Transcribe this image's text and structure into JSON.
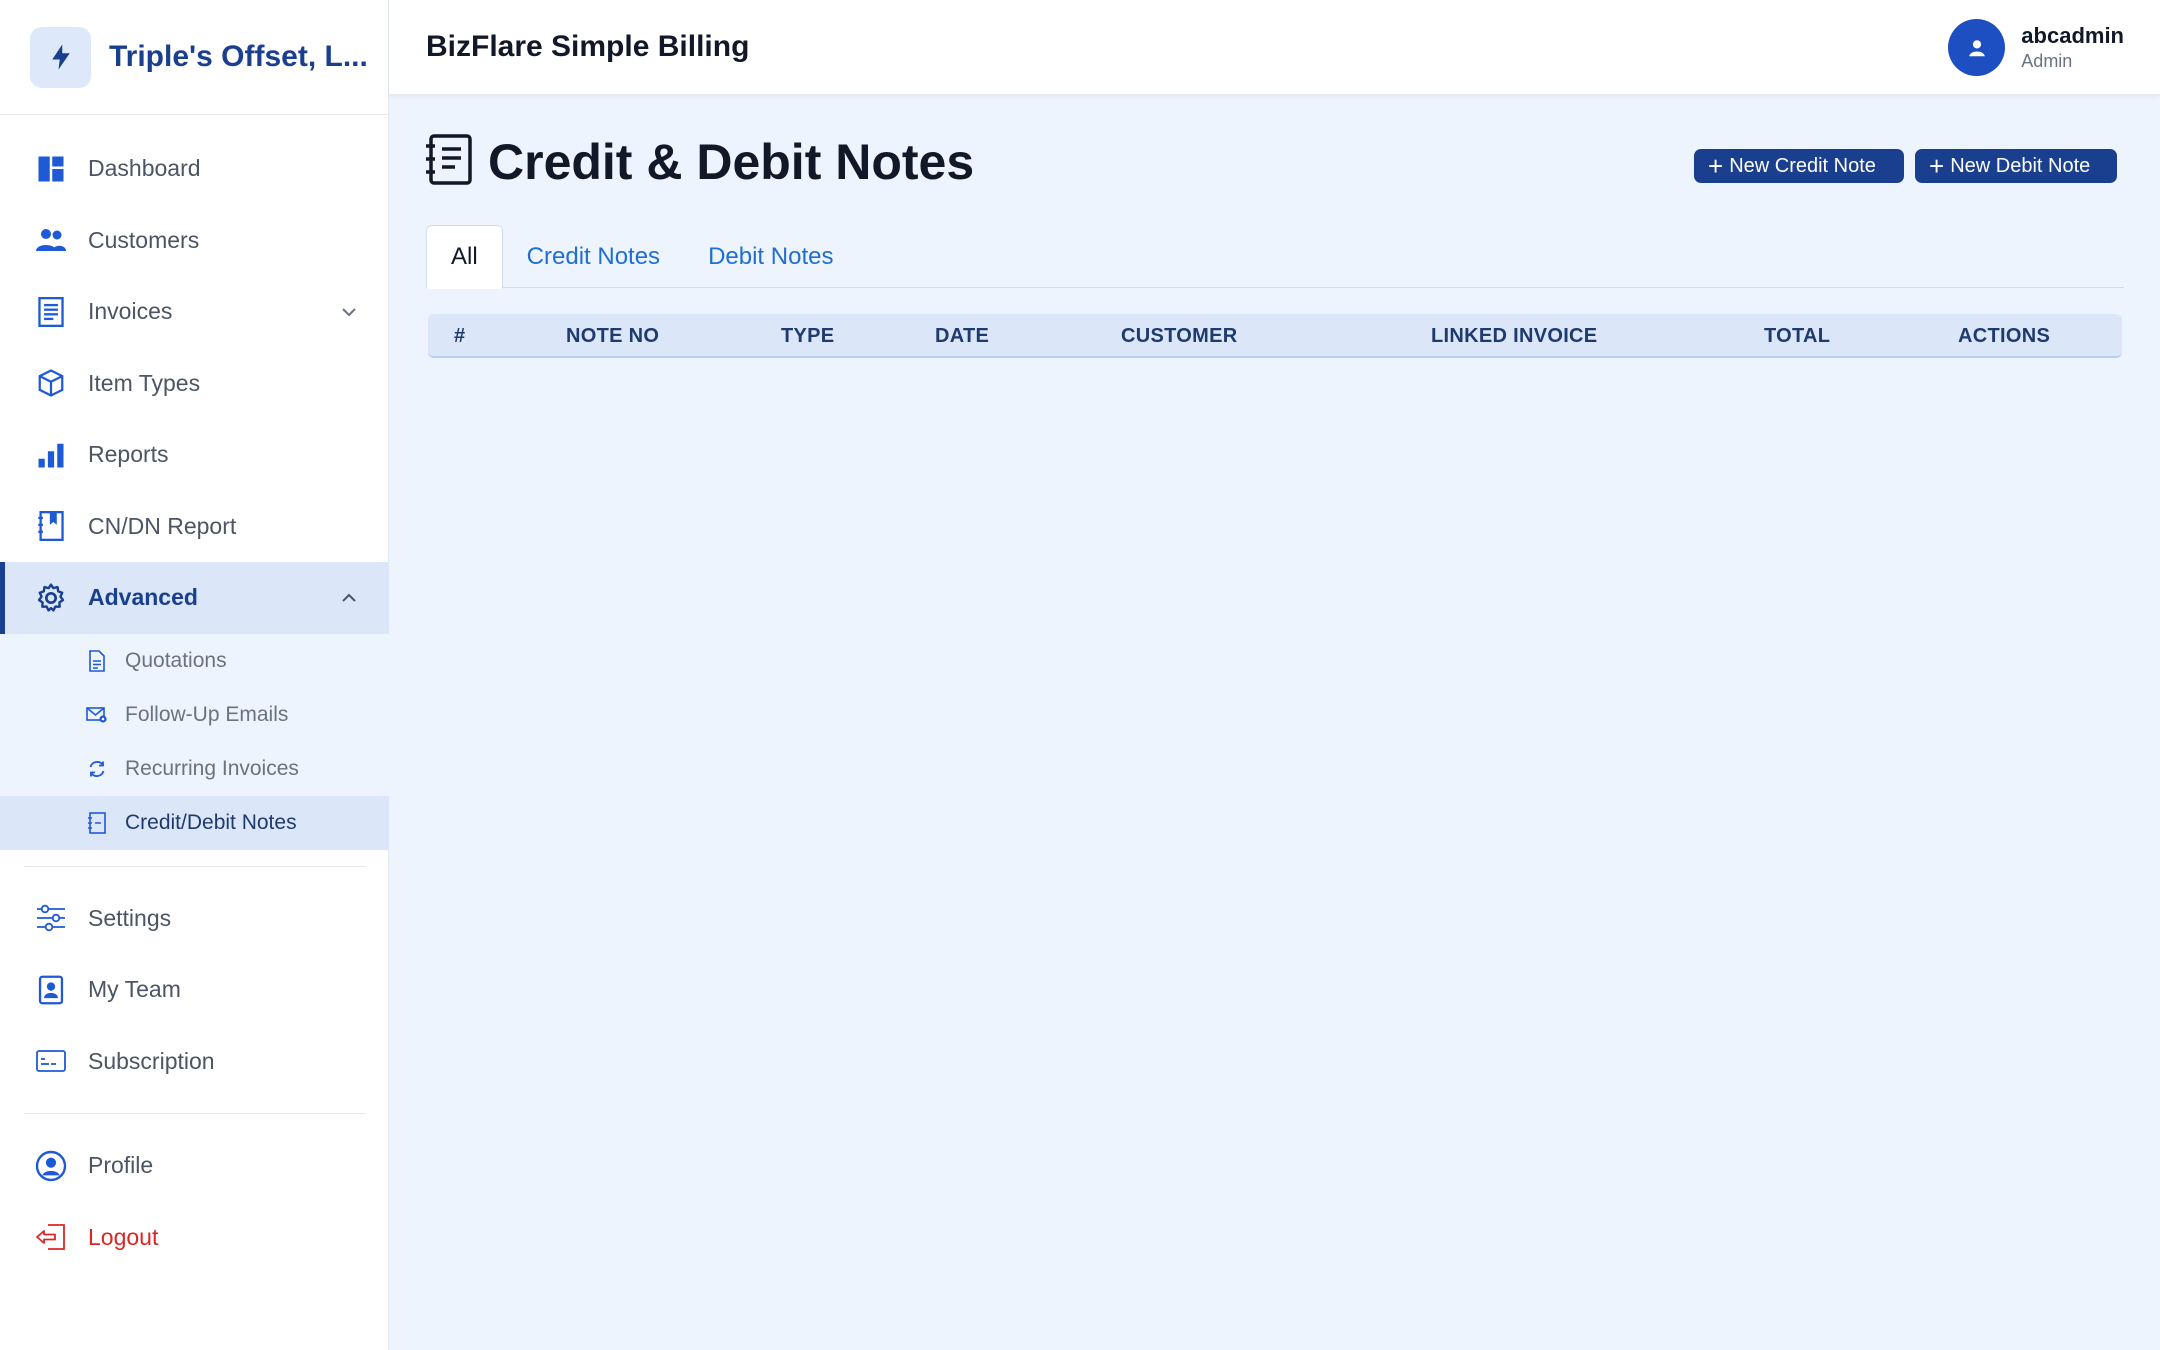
{
  "brand": {
    "name": "Triple's Offset, L...",
    "icon": "lightning-icon"
  },
  "sidebar": {
    "items": [
      {
        "label": "Dashboard",
        "icon": "dashboard-icon"
      },
      {
        "label": "Customers",
        "icon": "users-icon"
      },
      {
        "label": "Invoices",
        "icon": "invoice-icon"
      },
      {
        "label": "Item Types",
        "icon": "box-icon"
      },
      {
        "label": "Reports",
        "icon": "bar-chart-icon"
      },
      {
        "label": "CN/DN Report",
        "icon": "bookmark-book-icon"
      },
      {
        "label": "Advanced",
        "icon": "gear-icon"
      }
    ],
    "sub_items": [
      {
        "label": "Quotations",
        "icon": "document-icon"
      },
      {
        "label": "Follow-Up Emails",
        "icon": "email-gear-icon"
      },
      {
        "label": "Recurring Invoices",
        "icon": "refresh-icon"
      },
      {
        "label": "Credit/Debit Notes",
        "icon": "notes-icon"
      }
    ],
    "lower_items": [
      {
        "label": "Settings",
        "icon": "sliders-icon"
      },
      {
        "label": "My Team",
        "icon": "id-badge-icon"
      },
      {
        "label": "Subscription",
        "icon": "card-icon"
      }
    ],
    "bottom_items": [
      {
        "label": "Profile",
        "icon": "user-circle-icon"
      },
      {
        "label": "Logout",
        "icon": "logout-icon"
      }
    ]
  },
  "header": {
    "title": "BizFlare Simple Billing",
    "user": {
      "name": "abcadmin",
      "role": "Admin"
    }
  },
  "page": {
    "title": "Credit & Debit Notes",
    "buttons": {
      "new_credit": "New Credit Note",
      "new_debit": "New Debit Note"
    },
    "tabs": [
      "All",
      "Credit Notes",
      "Debit Notes"
    ],
    "active_tab": "All",
    "columns": [
      "#",
      "NOTE NO",
      "TYPE",
      "DATE",
      "CUSTOMER",
      "LINKED INVOICE",
      "TOTAL",
      "ACTIONS"
    ],
    "rows": []
  },
  "colors": {
    "primary": "#1a3f8f",
    "accent": "#1f6fd1",
    "background": "#eef4fd",
    "danger": "#dc2626"
  }
}
